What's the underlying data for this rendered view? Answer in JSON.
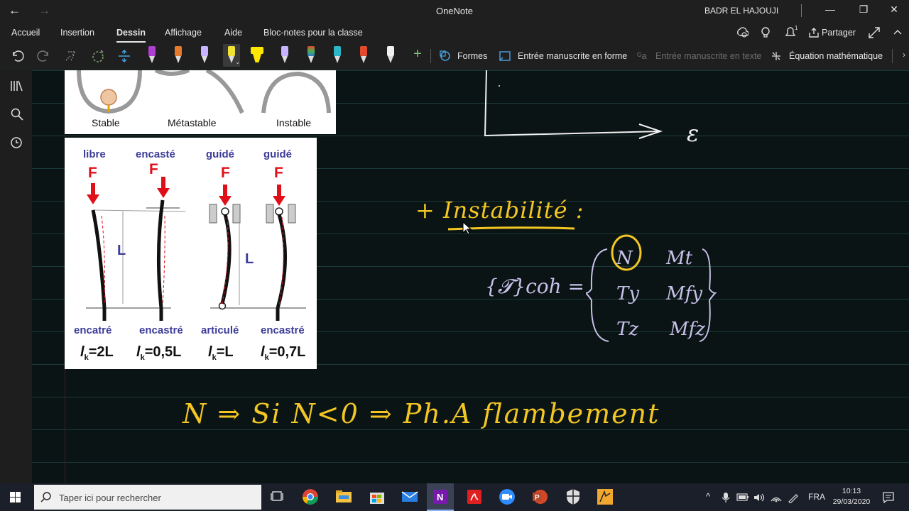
{
  "titlebar": {
    "app_title": "OneNote",
    "user": "BADR EL HAJOUJI",
    "back_glyph": "←",
    "forward_glyph": "→",
    "min_glyph": "—",
    "max_glyph": "❐",
    "close_glyph": "✕"
  },
  "tabs": [
    {
      "label": "Accueil"
    },
    {
      "label": "Insertion"
    },
    {
      "label": "Dessin"
    },
    {
      "label": "Affichage"
    },
    {
      "label": "Aide"
    },
    {
      "label": "Bloc-notes pour la classe"
    }
  ],
  "ribbon_right": {
    "share_label": "Partager"
  },
  "toolbar": {
    "shapes_label": "Formes",
    "ink_to_shape_label": "Entrée manuscrite en forme",
    "ink_to_text_label": "Entrée manuscrite en texte",
    "math_label": "Équation mathématique",
    "pen_colors": [
      "#b03fd1",
      "#e87a2c",
      "#c7b3ff",
      "#f2e232",
      "#ffe600",
      "#c7b3ff",
      "#4caf50",
      "#2bb7c7",
      "#e24a2c",
      "#f0f0f0"
    ]
  },
  "stability_image": {
    "labels": [
      "Stable",
      "Métastable",
      "Instable"
    ]
  },
  "buckling_image": {
    "top_labels": [
      "libre",
      "encasté",
      "guidé",
      "guidé"
    ],
    "force_label": "F",
    "length_label": "L",
    "bottom_labels": [
      "encatré",
      "encastré",
      "articulé",
      "encastré"
    ],
    "lk_values": [
      "=2L",
      "=0,5L",
      "=L",
      "=0,7L"
    ],
    "lk_prefix": "l",
    "lk_sub": "k"
  },
  "ink": {
    "epsilon": "ε",
    "heading": "+ Instabilité :",
    "torsor_left": "{𝓣}coh =",
    "matrix": [
      [
        "N",
        "Mt"
      ],
      [
        "Ty",
        "Mfy"
      ],
      [
        "Tz",
        "Mfz"
      ]
    ],
    "bottom_line": "N ⇒ Si N<0 ⇒ Ph.A flambement"
  },
  "taskbar": {
    "search_placeholder": "Taper ici pour rechercher",
    "language": "FRA",
    "time": "10:13",
    "date": "29/03/2020"
  }
}
